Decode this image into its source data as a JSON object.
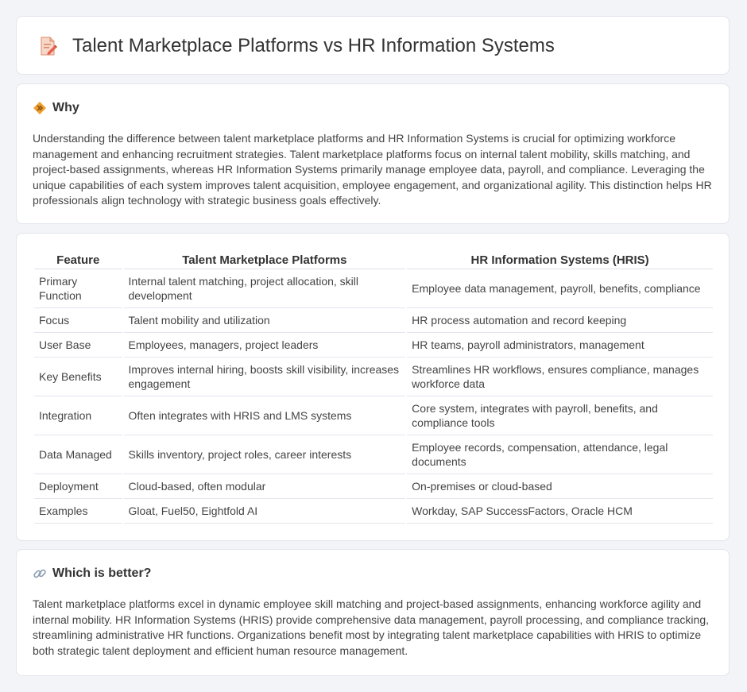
{
  "header": {
    "title": "Talent Marketplace Platforms vs HR Information Systems",
    "icon": "document-pencil-icon"
  },
  "why": {
    "heading": "Why",
    "icon": "diamond-sign-icon",
    "text": "Understanding the difference between talent marketplace platforms and HR Information Systems is crucial for optimizing workforce management and enhancing recruitment strategies. Talent marketplace platforms focus on internal talent mobility, skills matching, and project-based assignments, whereas HR Information Systems primarily manage employee data, payroll, and compliance. Leveraging the unique capabilities of each system improves talent acquisition, employee engagement, and organizational agility. This distinction helps HR professionals align technology with strategic business goals effectively."
  },
  "comparison": {
    "headers": [
      "Feature",
      "Talent Marketplace Platforms",
      "HR Information Systems (HRIS)"
    ],
    "rows": [
      [
        "Primary Function",
        "Internal talent matching, project allocation, skill development",
        "Employee data management, payroll, benefits, compliance"
      ],
      [
        "Focus",
        "Talent mobility and utilization",
        "HR process automation and record keeping"
      ],
      [
        "User Base",
        "Employees, managers, project leaders",
        "HR teams, payroll administrators, management"
      ],
      [
        "Key Benefits",
        "Improves internal hiring, boosts skill visibility, increases engagement",
        "Streamlines HR workflows, ensures compliance, manages workforce data"
      ],
      [
        "Integration",
        "Often integrates with HRIS and LMS systems",
        "Core system, integrates with payroll, benefits, and compliance tools"
      ],
      [
        "Data Managed",
        "Skills inventory, project roles, career interests",
        "Employee records, compensation, attendance, legal documents"
      ],
      [
        "Deployment",
        "Cloud-based, often modular",
        "On-premises or cloud-based"
      ],
      [
        "Examples",
        "Gloat, Fuel50, Eightfold AI",
        "Workday, SAP SuccessFactors, Oracle HCM"
      ]
    ]
  },
  "better": {
    "heading": "Which is better?",
    "icon": "link-icon",
    "text": "Talent marketplace platforms excel in dynamic employee skill matching and project-based assignments, enhancing workforce agility and internal mobility. HR Information Systems (HRIS) provide comprehensive data management, payroll processing, and compliance tracking, streamlining administrative HR functions. Organizations benefit most by integrating talent marketplace capabilities with HRIS to optimize both strategic talent deployment and efficient human resource management."
  },
  "colors": {
    "background": "#f3f4f8",
    "card": "#ffffff",
    "accent_orange": "#f0a030",
    "icon_red": "#e8604c"
  }
}
